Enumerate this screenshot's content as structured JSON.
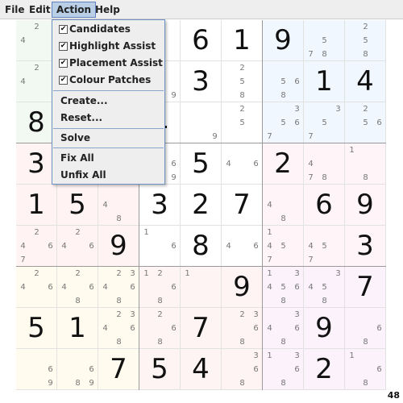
{
  "menubar": {
    "items": [
      "File",
      "Edit",
      "Action",
      "Help"
    ],
    "active": "Action"
  },
  "action_menu": {
    "check_items": [
      {
        "label": "Candidates",
        "checked": true
      },
      {
        "label": "Highlight Assist",
        "checked": true
      },
      {
        "label": "Placement Assist",
        "checked": true
      },
      {
        "label": "Colour Patches",
        "checked": true
      }
    ],
    "group2": [
      "Create...",
      "Reset..."
    ],
    "group3": [
      "Solve"
    ],
    "group4": [
      "Fix All",
      "Unfix All"
    ]
  },
  "status": {
    "count": "48"
  },
  "colors": {
    "box_patches": [
      "#f2f8f2",
      "#ffffff",
      "#f1f7ff",
      "#fff3f3",
      "#ffffff",
      "#fff4f8",
      "#fffbee",
      "#fff4f4",
      "#fbf2fb"
    ]
  },
  "grid": [
    [
      [
        2,
        4
      ],
      [],
      [],
      [],
      6,
      1,
      9,
      [
        5,
        7,
        8
      ],
      [
        2,
        5,
        8
      ]
    ],
    [
      [
        2,
        4
      ],
      [],
      [],
      [
        9
      ],
      3,
      [
        2,
        5,
        8
      ],
      [
        5,
        6,
        8
      ],
      1,
      4
    ],
    [
      8,
      [],
      [],
      [],
      [
        9
      ],
      [
        2,
        5
      ],
      [
        3,
        5,
        6,
        7
      ],
      [
        3,
        5,
        7
      ],
      [
        2,
        5,
        6
      ]
    ],
    [
      3,
      [],
      [],
      [
        6,
        9
      ],
      5,
      [
        4,
        6
      ],
      2,
      [
        4,
        7,
        8
      ],
      [
        1,
        8
      ]
    ],
    [
      1,
      5,
      [
        4,
        8
      ],
      3,
      2,
      7,
      [
        4,
        8
      ],
      6,
      9
    ],
    [
      [
        2,
        4,
        6,
        7
      ],
      [
        2,
        4,
        6
      ],
      9,
      [
        1,
        6
      ],
      8,
      [
        4,
        6
      ],
      [
        1,
        4,
        5,
        7
      ],
      [
        4,
        5,
        7
      ],
      3
    ],
    [
      [
        2,
        4,
        6
      ],
      [
        2,
        4,
        6,
        8
      ],
      [
        2,
        3,
        4,
        6,
        8
      ],
      [
        1,
        2,
        6,
        8
      ],
      [
        1
      ],
      9,
      [
        1,
        3,
        4,
        5,
        6,
        8
      ],
      [
        3,
        4,
        5,
        8
      ],
      7
    ],
    [
      5,
      1,
      [
        2,
        3,
        4,
        6,
        8
      ],
      [
        2,
        6,
        8
      ],
      7,
      [
        2,
        3,
        6,
        8
      ],
      [
        3,
        4,
        6,
        8
      ],
      9,
      [
        6,
        8
      ]
    ],
    [
      [
        6,
        9
      ],
      [
        6,
        8,
        9
      ],
      7,
      5,
      4,
      [
        3,
        6,
        8
      ],
      [
        1,
        3,
        6,
        8
      ],
      2,
      [
        1,
        6,
        8
      ]
    ]
  ]
}
